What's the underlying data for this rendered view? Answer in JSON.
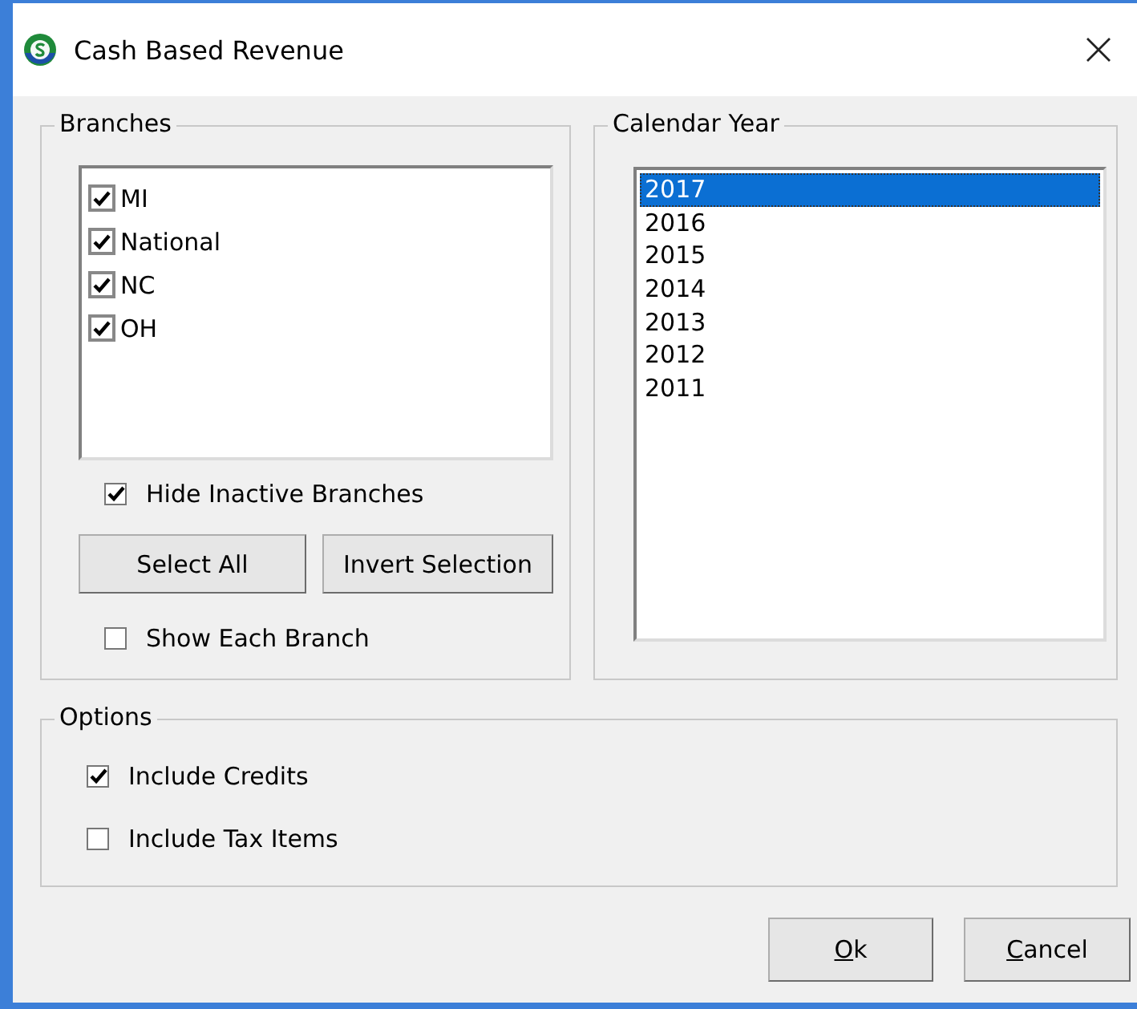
{
  "window": {
    "title": "Cash Based Revenue"
  },
  "branches": {
    "title": "Branches",
    "items": [
      {
        "label": "MI",
        "checked": true
      },
      {
        "label": "National",
        "checked": true
      },
      {
        "label": "NC",
        "checked": true
      },
      {
        "label": "OH",
        "checked": true
      }
    ],
    "hide_inactive": {
      "label": "Hide Inactive Branches",
      "checked": true
    },
    "buttons": [
      {
        "label": "Select All"
      },
      {
        "label": "Invert Selection"
      }
    ],
    "show_each": {
      "label": "Show Each Branch",
      "checked": false
    }
  },
  "calendar_year": {
    "title": "Calendar Year",
    "items": [
      {
        "label": "2017",
        "selected": true
      },
      {
        "label": "2016",
        "selected": false
      },
      {
        "label": "2015",
        "selected": false
      },
      {
        "label": "2014",
        "selected": false
      },
      {
        "label": "2013",
        "selected": false
      },
      {
        "label": "2012",
        "selected": false
      },
      {
        "label": "2011",
        "selected": false
      }
    ]
  },
  "options": {
    "title": "Options",
    "items": [
      {
        "label": "Include Credits",
        "checked": true
      },
      {
        "label": "Include Tax Items",
        "checked": false
      }
    ]
  },
  "buttons": [
    {
      "label": "Ok",
      "first_letter_underlined": true
    },
    {
      "label": "Cancel",
      "first_letter_underlined": true
    }
  ]
}
